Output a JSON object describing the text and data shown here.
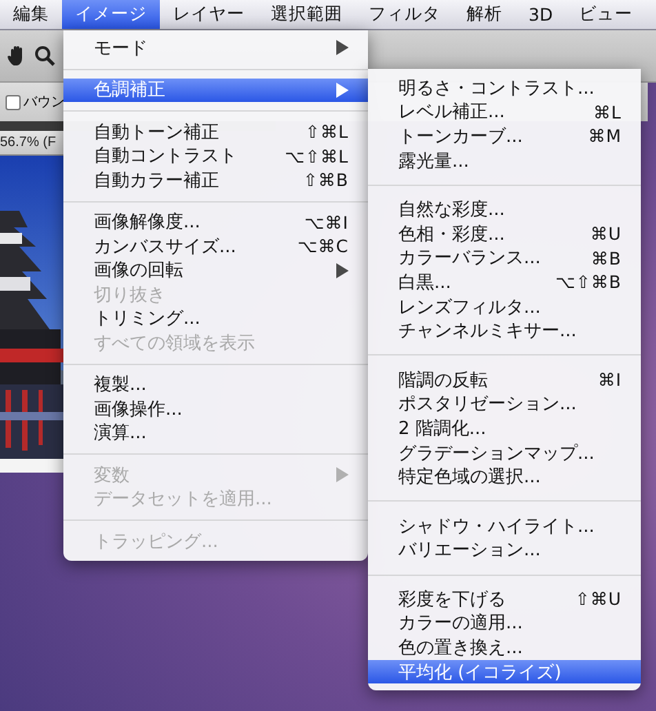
{
  "menubar": [
    {
      "label": "編集",
      "selected": false
    },
    {
      "label": "イメージ",
      "selected": true
    },
    {
      "label": "レイヤー",
      "selected": false
    },
    {
      "label": "選択範囲",
      "selected": false
    },
    {
      "label": "フィルタ",
      "selected": false
    },
    {
      "label": "解析",
      "selected": false
    },
    {
      "label": "3D",
      "selected": false
    },
    {
      "label": "ビュー",
      "selected": false
    }
  ],
  "tool_options": {
    "checkbox_label": "バウン",
    "checked": false
  },
  "document": {
    "title": "56.7% (F"
  },
  "image_menu": {
    "items": [
      {
        "kind": "item",
        "label": "モード",
        "submenu": true,
        "disabled": false,
        "selected": false
      },
      {
        "kind": "separator"
      },
      {
        "kind": "item",
        "label": "色調補正",
        "submenu": true,
        "disabled": false,
        "selected": true
      },
      {
        "kind": "separator"
      },
      {
        "kind": "item",
        "label": "自動トーン補正",
        "shortcut": "⇧⌘L",
        "submenu": false,
        "disabled": false,
        "selected": false
      },
      {
        "kind": "item",
        "label": "自動コントラスト",
        "shortcut": "⌥⇧⌘L",
        "submenu": false,
        "disabled": false,
        "selected": false
      },
      {
        "kind": "item",
        "label": "自動カラー補正",
        "shortcut": "⇧⌘B",
        "submenu": false,
        "disabled": false,
        "selected": false
      },
      {
        "kind": "separator"
      },
      {
        "kind": "item",
        "label": "画像解像度...",
        "shortcut": "⌥⌘I",
        "submenu": false,
        "disabled": false,
        "selected": false
      },
      {
        "kind": "item",
        "label": "カンバスサイズ...",
        "shortcut": "⌥⌘C",
        "submenu": false,
        "disabled": false,
        "selected": false
      },
      {
        "kind": "item",
        "label": "画像の回転",
        "submenu": true,
        "disabled": false,
        "selected": false
      },
      {
        "kind": "item",
        "label": "切り抜き",
        "submenu": false,
        "disabled": true,
        "selected": false
      },
      {
        "kind": "item",
        "label": "トリミング...",
        "submenu": false,
        "disabled": false,
        "selected": false
      },
      {
        "kind": "item",
        "label": "すべての領域を表示",
        "submenu": false,
        "disabled": true,
        "selected": false
      },
      {
        "kind": "separator"
      },
      {
        "kind": "item",
        "label": "複製...",
        "submenu": false,
        "disabled": false,
        "selected": false
      },
      {
        "kind": "item",
        "label": "画像操作...",
        "submenu": false,
        "disabled": false,
        "selected": false
      },
      {
        "kind": "item",
        "label": "演算...",
        "submenu": false,
        "disabled": false,
        "selected": false
      },
      {
        "kind": "separator"
      },
      {
        "kind": "item",
        "label": "変数",
        "submenu": true,
        "disabled": true,
        "selected": false
      },
      {
        "kind": "item",
        "label": "データセットを適用...",
        "submenu": false,
        "disabled": true,
        "selected": false
      },
      {
        "kind": "separator"
      },
      {
        "kind": "item",
        "label": "トラッピング...",
        "submenu": false,
        "disabled": true,
        "selected": false
      }
    ]
  },
  "adjustments_submenu": {
    "items": [
      {
        "kind": "item",
        "label": "明るさ・コントラスト...",
        "submenu": false,
        "disabled": false,
        "selected": false
      },
      {
        "kind": "item",
        "label": "レベル補正...",
        "shortcut": "⌘L",
        "submenu": false,
        "disabled": false,
        "selected": false
      },
      {
        "kind": "item",
        "label": "トーンカーブ...",
        "shortcut": "⌘M",
        "submenu": false,
        "disabled": false,
        "selected": false
      },
      {
        "kind": "item",
        "label": "露光量...",
        "submenu": false,
        "disabled": false,
        "selected": false
      },
      {
        "kind": "separator"
      },
      {
        "kind": "item",
        "label": "自然な彩度...",
        "submenu": false,
        "disabled": false,
        "selected": false
      },
      {
        "kind": "item",
        "label": "色相・彩度...",
        "shortcut": "⌘U",
        "submenu": false,
        "disabled": false,
        "selected": false
      },
      {
        "kind": "item",
        "label": "カラーバランス...",
        "shortcut": "⌘B",
        "submenu": false,
        "disabled": false,
        "selected": false
      },
      {
        "kind": "item",
        "label": "白黒...",
        "shortcut": "⌥⇧⌘B",
        "submenu": false,
        "disabled": false,
        "selected": false
      },
      {
        "kind": "item",
        "label": "レンズフィルタ...",
        "submenu": false,
        "disabled": false,
        "selected": false
      },
      {
        "kind": "item",
        "label": "チャンネルミキサー...",
        "submenu": false,
        "disabled": false,
        "selected": false
      },
      {
        "kind": "separator"
      },
      {
        "kind": "item",
        "label": "階調の反転",
        "shortcut": "⌘I",
        "submenu": false,
        "disabled": false,
        "selected": false
      },
      {
        "kind": "item",
        "label": "ポスタリゼーション...",
        "submenu": false,
        "disabled": false,
        "selected": false
      },
      {
        "kind": "item",
        "label": "2 階調化...",
        "submenu": false,
        "disabled": false,
        "selected": false
      },
      {
        "kind": "item",
        "label": "グラデーションマップ...",
        "submenu": false,
        "disabled": false,
        "selected": false
      },
      {
        "kind": "item",
        "label": "特定色域の選択...",
        "submenu": false,
        "disabled": false,
        "selected": false
      },
      {
        "kind": "separator"
      },
      {
        "kind": "item",
        "label": "シャドウ・ハイライト...",
        "submenu": false,
        "disabled": false,
        "selected": false
      },
      {
        "kind": "item",
        "label": "バリエーション...",
        "submenu": false,
        "disabled": false,
        "selected": false
      },
      {
        "kind": "separator"
      },
      {
        "kind": "item",
        "label": "彩度を下げる",
        "shortcut": "⇧⌘U",
        "submenu": false,
        "disabled": false,
        "selected": false
      },
      {
        "kind": "item",
        "label": "カラーの適用...",
        "submenu": false,
        "disabled": false,
        "selected": false
      },
      {
        "kind": "item",
        "label": "色の置き換え...",
        "submenu": false,
        "disabled": false,
        "selected": false
      },
      {
        "kind": "item",
        "label": "平均化 (イコライズ)",
        "submenu": false,
        "disabled": false,
        "selected": true
      }
    ]
  }
}
